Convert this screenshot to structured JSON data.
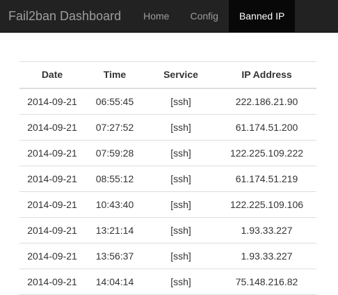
{
  "navbar": {
    "brand": "Fail2ban Dashboard",
    "items": [
      {
        "label": "Home",
        "active": false
      },
      {
        "label": "Config",
        "active": false
      },
      {
        "label": "Banned IP",
        "active": true
      }
    ]
  },
  "table": {
    "headers": [
      "Date",
      "Time",
      "Service",
      "IP Address"
    ],
    "rows": [
      [
        "2014-09-21",
        "06:55:45",
        "[ssh]",
        "222.186.21.90"
      ],
      [
        "2014-09-21",
        "07:27:52",
        "[ssh]",
        "61.174.51.200"
      ],
      [
        "2014-09-21",
        "07:59:28",
        "[ssh]",
        "122.225.109.222"
      ],
      [
        "2014-09-21",
        "08:55:12",
        "[ssh]",
        "61.174.51.219"
      ],
      [
        "2014-09-21",
        "10:43:40",
        "[ssh]",
        "122.225.109.106"
      ],
      [
        "2014-09-21",
        "13:21:14",
        "[ssh]",
        "1.93.33.227"
      ],
      [
        "2014-09-21",
        "13:56:37",
        "[ssh]",
        "1.93.33.227"
      ],
      [
        "2014-09-21",
        "14:04:14",
        "[ssh]",
        "75.148.216.82"
      ]
    ]
  },
  "colors": {
    "navbar_bg": "#222222",
    "navbar_active_bg": "#080808",
    "nav_text": "#9d9d9d",
    "nav_active_text": "#ffffff",
    "border": "#dddddd"
  }
}
